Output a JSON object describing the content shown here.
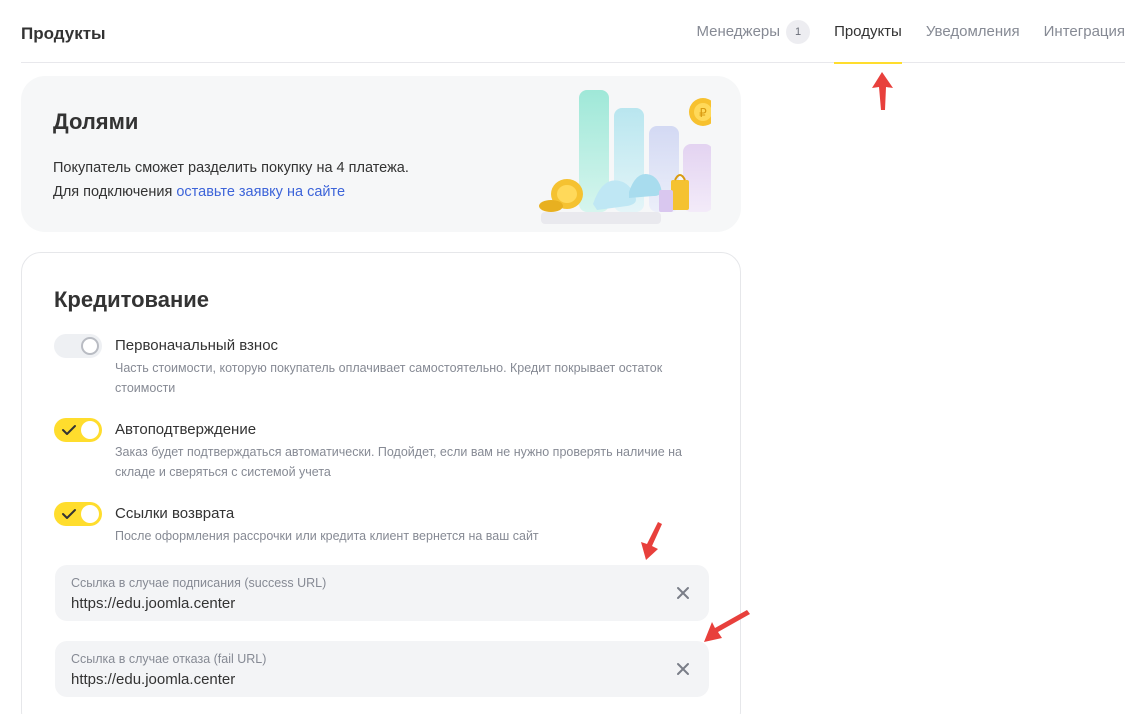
{
  "header": {
    "title": "Продукты",
    "tabs": [
      {
        "label": "Менеджеры",
        "badge": "1",
        "active": false
      },
      {
        "label": "Продукты",
        "active": true
      },
      {
        "label": "Уведомления",
        "active": false
      },
      {
        "label": "Интеграция",
        "active": false
      }
    ]
  },
  "dolyami": {
    "title": "Долями",
    "line1": "Покупатель сможет разделить покупку на 4 платежа.",
    "line2_prefix": "Для подключения ",
    "line2_link": "оставьте заявку на сайте"
  },
  "credit": {
    "title": "Кредитование",
    "options": [
      {
        "label": "Первоначальный взнос",
        "description": "Часть стоимости, которую покупатель оплачивает самостоятельно. Кредит покрывает остаток стоимости",
        "enabled": false
      },
      {
        "label": "Автоподтверждение",
        "description": "Заказ будет подтверждаться автоматически. Подойдет, если вам не нужно проверять наличие на складе и сверяться с системой учета",
        "enabled": true
      },
      {
        "label": "Ссылки возврата",
        "description": "После оформления рассрочки или кредита клиент вернется на ваш сайт",
        "enabled": true
      }
    ],
    "success_url": {
      "label": "Ссылка в случае подписания (success URL)",
      "value": "https://edu.joomla.center"
    },
    "fail_url": {
      "label": "Ссылка в случае отказа (fail URL)",
      "value": "https://edu.joomla.center"
    }
  },
  "colors": {
    "accent": "#ffdd2d",
    "link": "#3d64d9",
    "annotation_arrow": "#e8403c"
  }
}
